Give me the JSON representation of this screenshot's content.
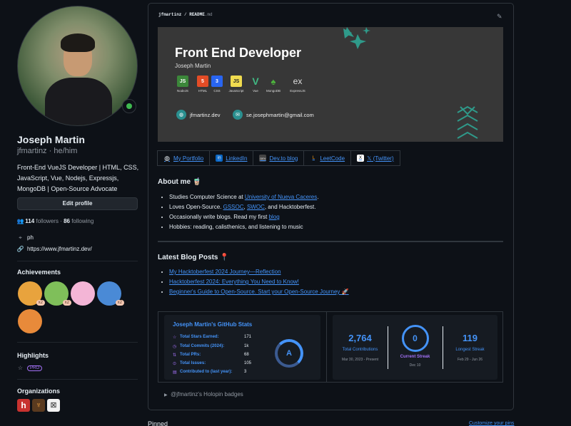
{
  "profile": {
    "name": "Joseph Martin",
    "login": "jfmartinz · he/him",
    "bio": "Front-End VueJS Developer | HTML, CSS, JavaScript, Vue, Nodejs, Expressjs, MongoDB | Open-Source Advocate",
    "edit_label": "Edit profile",
    "followers_count": "114",
    "followers_label": "followers ·",
    "following_count": "86",
    "following_label": "following",
    "location": "ph",
    "website": "https://www.jfmartinz.dev/"
  },
  "sidebar": {
    "achievements_title": "Achievements",
    "badges": [
      {
        "count": "x2",
        "color": "#e8a33d"
      },
      {
        "count": "x2",
        "color": "#7fbf5a"
      },
      {
        "count": "",
        "color": "#f3b5d6"
      },
      {
        "count": "x2",
        "color": "#4a8ad6"
      },
      {
        "count": "",
        "color": "#e88a3a"
      }
    ],
    "highlights_title": "Highlights",
    "pro_label": "PRO",
    "organizations_title": "Organizations"
  },
  "readme": {
    "path_user": "jfmartinz",
    "path_sep": " / ",
    "path_file": "README",
    "path_ext": ".md"
  },
  "banner": {
    "title": "Front End Developer",
    "subtitle": "Joseph Martin",
    "tech": [
      {
        "label": "NodeJS",
        "glyph": "JS",
        "color": "#3c873a"
      },
      {
        "label": "HTML",
        "glyph": "5",
        "color": "#e34c26"
      },
      {
        "label": "CSS",
        "glyph": "3",
        "color": "#2965f1"
      },
      {
        "label": "JavaScript",
        "glyph": "JS",
        "color": "#f0db4f"
      },
      {
        "label": "Vue",
        "glyph": "V",
        "color": "#41b883"
      },
      {
        "label": "MongoDB",
        "glyph": "♠",
        "color": "#4db33d"
      },
      {
        "label": "ExpressJS",
        "glyph": "ex",
        "color": "#555555"
      }
    ],
    "site": "jfmartinz.dev",
    "email": "se.josephmartin@gmail.com"
  },
  "links": [
    {
      "label": "My Portfolio",
      "icon": "globe-icon",
      "glyph": "◍"
    },
    {
      "label": "LinkedIn",
      "icon": "linkedin-icon",
      "glyph": "in"
    },
    {
      "label": "Dev.to blog",
      "icon": "devto-icon",
      "glyph": "DEV"
    },
    {
      "label": "LeetCode",
      "icon": "leetcode-icon",
      "glyph": "L"
    },
    {
      "label": "𝕏 (Twitter)",
      "icon": "x-icon",
      "glyph": "X"
    }
  ],
  "about": {
    "title": "About me 🧋",
    "line1_pre": "Studies Computer Science at ",
    "line1_link": "University of Nueva Caceres",
    "line1_post": ".",
    "line2_pre": "Loves Open-Source. ",
    "line2_link1": "GSSOC",
    "line2_mid1": ", ",
    "line2_link2": "SWOC",
    "line2_post": ", and Hacktoberfest.",
    "line3_pre": "Occasionally write blogs. Read my first ",
    "line3_link": "blog",
    "line4": "Hobbies: reading, calisthenics, and listening to music"
  },
  "blog": {
    "title": "Latest Blog Posts 📍",
    "posts": [
      "My Hacktoberfest 2024 Journey—Reflection",
      "Hacktoberfest 2024: Everything You Need to Know!",
      "Beginner's Guide to Open-Source. Start your Open-Source Journey 🚀"
    ]
  },
  "stats": {
    "title": "Joseph Martin's GitHub Stats",
    "rows": [
      {
        "label": "Total Stars Earned:",
        "value": "171"
      },
      {
        "label": "Total Commits (2024):",
        "value": "1k"
      },
      {
        "label": "Total PRs:",
        "value": "68"
      },
      {
        "label": "Total Issues:",
        "value": "105"
      },
      {
        "label": "Contributed to (last year):",
        "value": "3"
      }
    ],
    "grade": "A",
    "total_contrib": "2,764",
    "total_contrib_label": "Total Contributions",
    "total_contrib_date": "Mar 30, 2023 - Present",
    "current_streak": "0",
    "current_streak_label": "Current Streak",
    "current_streak_date": "Dec 10",
    "longest_streak": "119",
    "longest_streak_label": "Longest Streak",
    "longest_streak_date": "Feb 29 - Jun 26"
  },
  "holopin": "@jfmartinz's Holopin badges",
  "footer": {
    "pinned": "Pinned",
    "customize": "Customize your pins"
  }
}
